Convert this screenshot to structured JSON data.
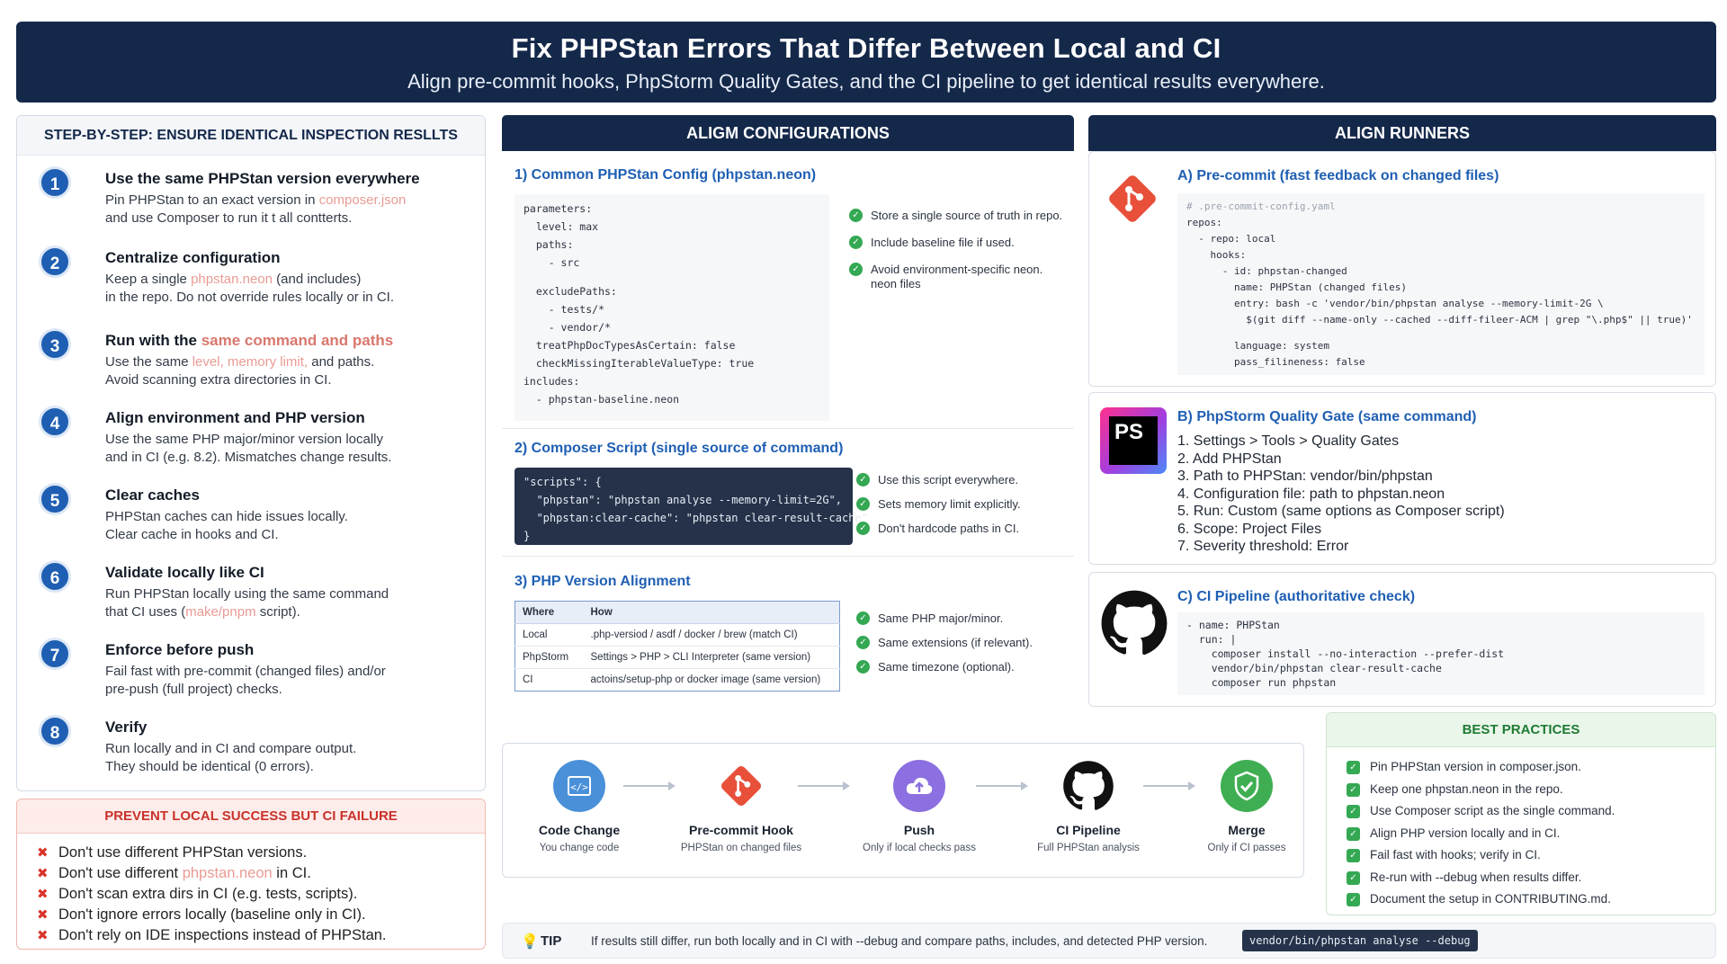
{
  "header": {
    "title": "Fix PHPStan Errors That Differ Between Local and CI",
    "subtitle": "Align pre-commit hooks, PhpStorm Quality Gates, and the CI pipeline to get identical results everywhere."
  },
  "steps": {
    "heading": "STEP-BY-STEP: ENSURE IDENTICAL INSPECTION RESLLTS",
    "items": [
      {
        "num": "1",
        "title": "Use the same PHPStan version everywhere",
        "b1": "Pin PHPStan to an exact version in ",
        "b1h": "composer.json",
        "b2": "and use Composer to run it t all contterts."
      },
      {
        "num": "2",
        "title": "Centralize configuration",
        "b1": "Keep a single ",
        "b1h": "phpstan.neon",
        "b1t": " (and includes)",
        "b2": "in the repo. Do not override rules locally or in CI."
      },
      {
        "num": "3",
        "title_a": "Run with the ",
        "title_h": "same command and paths",
        "b1": "Use the same ",
        "b1h": "level, memory limit,",
        "b1t": " and paths.",
        "b2": "Avoid scanning extra directories in CI."
      },
      {
        "num": "4",
        "title": "Align environment and PHP version",
        "b1": "Use the same PHP major/minor version locally",
        "b2": "and in CI (e.g. 8.2). Mismatches change results."
      },
      {
        "num": "5",
        "title": "Clear caches",
        "b1": "PHPStan caches can hide issues locally.",
        "b2": "Clear cache in hooks and CI."
      },
      {
        "num": "6",
        "title": "Validate locally like CI",
        "b1": "Run PHPStan locally using the same command",
        "b2a": "that CI uses (",
        "b2h": "make/pnpm",
        "b2t": " script)."
      },
      {
        "num": "7",
        "title": "Enforce before push",
        "b1": "Fail fast with pre-commit (changed files) and/or",
        "b2": "pre-push (full project) checks."
      },
      {
        "num": "8",
        "title": "Verify",
        "b1": "Run locally and in CI and compare output.",
        "b2": "They should be identical (0 errors)."
      }
    ]
  },
  "prevent": {
    "heading": "PREVENT LOCAL SUCCESS BUT CI FAILURE",
    "items": [
      "Don't use different PHPStan versions.",
      "Don't use different ",
      "Don't scan extra dirs in CI (e.g. tests, scripts).",
      "Don't ignore errors locally (baseline only in CI).",
      "Don't rely on IDE inspections instead of PHPStan."
    ],
    "item2_hl": "phpstan.neon",
    "item2_tail": " in CI."
  },
  "config": {
    "heading": "ALIGM CONFIGURATIONS",
    "s1_title": "1) Common PHPStan Config (phpstan.neon)",
    "s1_code": [
      "parameters:",
      "  level: max",
      "  paths:",
      "    - src",
      "",
      "  excludePaths:",
      "    - tests/*",
      "    - vendor/*",
      "  treatPhpDocTypesAsCertain: false",
      "  checkMissingIterableValueType: true",
      "includes:",
      "  - phpstan-baseline.neon"
    ],
    "s1_checks": [
      "Store a single source of truth in repo.",
      "Include baseline file if used.",
      "Avoid environment-specific neon. neon files"
    ],
    "s2_title": "2) Composer Script (single source of command)",
    "s2_code": [
      "\"scripts\": {",
      "  \"phpstan\": \"phpstan analyse --memory-limit=2G\",",
      "  \"phpstan:clear-cache\": \"phpstan clear-result-cache\"",
      "}"
    ],
    "s2_checks": [
      "Use this script everywhere.",
      "Sets memory limit explicitly.",
      "Don't hardcode paths in CI."
    ],
    "s3_title": "3) PHP Version Alignment",
    "s3_table": {
      "headers": [
        "Where",
        "How"
      ],
      "rows": [
        [
          "Local",
          ".php-versiod / asdf / docker / brew (match CI)"
        ],
        [
          "PhpStorm",
          "Settings > PHP > CLI Interpreter (same version)"
        ],
        [
          "CI",
          "actoins/setup-php or docker image (same version)"
        ]
      ]
    },
    "s3_checks": [
      "Same PHP major/minor.",
      "Same extensions (if relevant).",
      "Same timezone (optional)."
    ]
  },
  "runners": {
    "heading": "ALIGN RUNNERS",
    "a_title": "A) Pre-commit (fast feedback on changed files)",
    "a_code": [
      "# .pre-commit-config.yaml",
      "repos:",
      "  - repo: local",
      "    hooks:",
      "      - id: phpstan-changed",
      "        name: PHPStan (changed files)",
      "        entry: bash -c 'vendor/bin/phpstan analyse --memory-limit-2G \\",
      "          $(git diff --name-only --cached --diff-fileer-ACM | grep \"\\.php$\" || true)'",
      "",
      "        language: system",
      "        pass_filineness: false"
    ],
    "b_title": "B) PhpStorm Quality Gate (same command)",
    "b_list": [
      "1. Settings > Tools > Quality Gates",
      "2. Add PHPStan",
      "3. Path to PHPStan: vendor/bin/phpstan",
      "4. Configuration file: path to phpstan.neon",
      "5. Run: Custom (same options as Composer script)",
      "6. Scope: Project Files",
      "7. Severity threshold: Error"
    ],
    "c_title": "C) CI Pipeline (authoritative check)",
    "c_code": [
      "- name: PHPStan",
      "  run: |",
      "    composer install --no-interaction --prefer-dist",
      "    vendor/bin/phpstan clear-result-cache",
      "    composer run phpstan"
    ],
    "ps_logo": "PS"
  },
  "flow": {
    "nodes": [
      {
        "label": "Code Change",
        "sub": "You change code",
        "icon": "code-icon",
        "color": "#4a90d9"
      },
      {
        "label": "Pre-commit Hook",
        "sub": "PHPStan on changed files",
        "icon": "git-icon",
        "color": "#e8503a"
      },
      {
        "label": "Push",
        "sub": "Only if local checks pass",
        "icon": "cloud-upload-icon",
        "color": "#8c6fe0"
      },
      {
        "label": "CI Pipeline",
        "sub": "Full PHPStan analysis",
        "icon": "github-icon",
        "color": "#1a1a1a"
      },
      {
        "label": "Merge",
        "sub": "Only if CI passes",
        "icon": "shield-check-icon",
        "color": "#3fae52"
      }
    ]
  },
  "best": {
    "heading": "BEST PRACTICES",
    "items": [
      "Pin PHPStan version in composer.json.",
      "Keep one phpstan.neon in the repo.",
      "Use Composer script as the single command.",
      "Align PHP version locally and in CI.",
      "Fail fast with hooks; verify in CI.",
      "Re-run with --debug when results differ.",
      "Document the setup in CONTRIBUTING.md."
    ]
  },
  "tip": {
    "label": "TIP",
    "text": "If results still differ, run both locally and in CI with --debug and compare paths, includes, and detected PHP version.",
    "code": "vendor/bin/phpstan analyse --debug"
  }
}
